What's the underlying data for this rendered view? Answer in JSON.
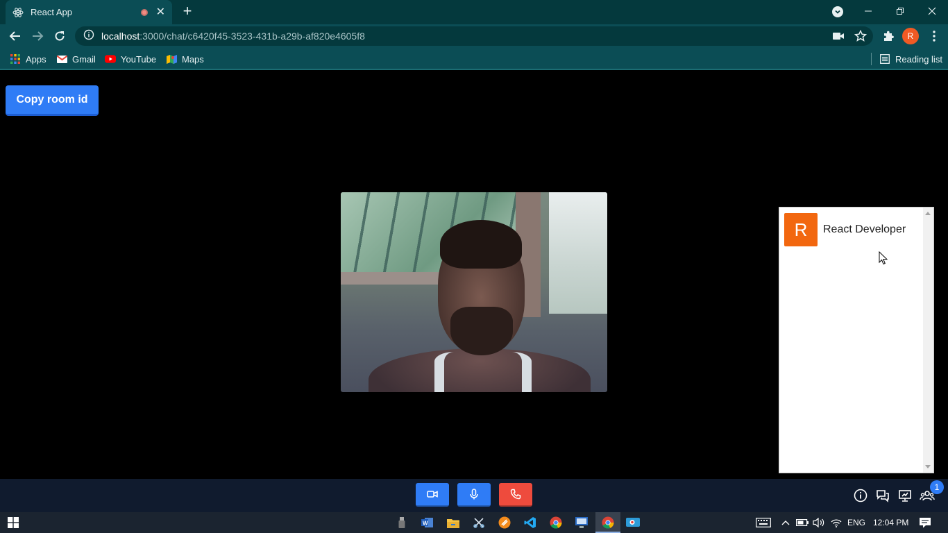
{
  "browser": {
    "tab_title": "React App",
    "url_host": "localhost",
    "url_path": ":3000/chat/c6420f45-3523-431b-a29b-af820e4605f8",
    "profile_initial": "R",
    "bookmarks": [
      {
        "label": "Apps",
        "icon": "apps-grid-icon"
      },
      {
        "label": "Gmail",
        "icon": "gmail-icon"
      },
      {
        "label": "YouTube",
        "icon": "youtube-icon"
      },
      {
        "label": "Maps",
        "icon": "maps-icon"
      }
    ],
    "reading_list_label": "Reading list"
  },
  "page": {
    "copy_button_label": "Copy room id",
    "participants": [
      {
        "initial": "R",
        "name": "React Developer",
        "color": "#f2670f"
      }
    ]
  },
  "controls": {
    "video_button_icon": "video-camera-icon",
    "mic_button_icon": "microphone-icon",
    "hangup_button_icon": "phone-icon",
    "participants_badge": "1",
    "accent": "#2f7cf6",
    "danger": "#ee4b3d"
  },
  "taskbar": {
    "language": "ENG",
    "time": "12:04 PM"
  }
}
